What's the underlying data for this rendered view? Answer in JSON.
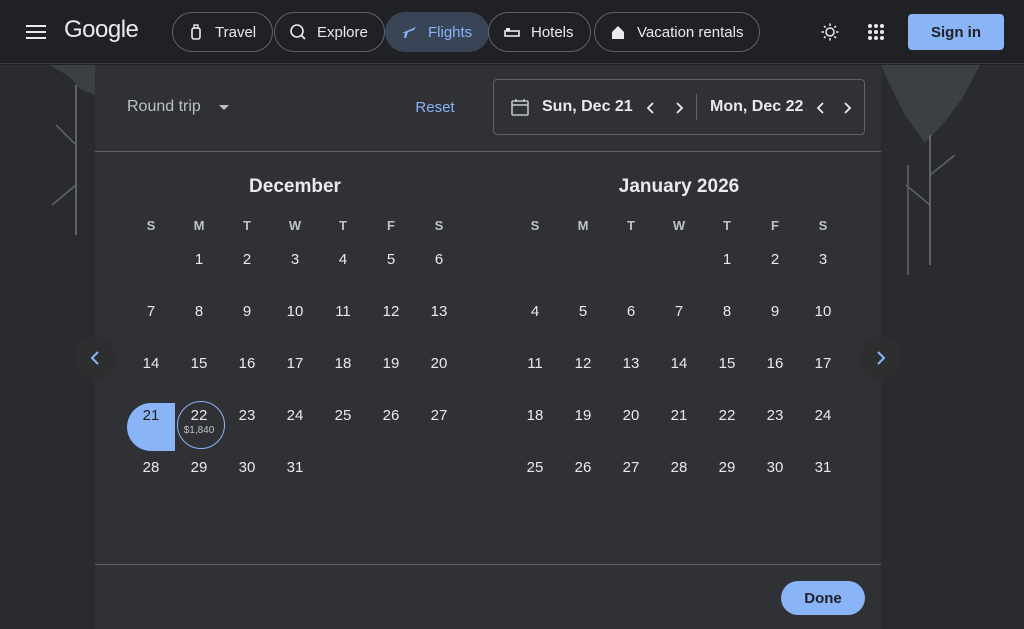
{
  "header": {
    "logo": "Google",
    "tabs": [
      {
        "label": "Travel",
        "icon": "suitcase-icon"
      },
      {
        "label": "Explore",
        "icon": "explore-icon"
      },
      {
        "label": "Flights",
        "icon": "airplane-icon",
        "active": true
      },
      {
        "label": "Hotels",
        "icon": "bed-icon"
      },
      {
        "label": "Vacation rentals",
        "icon": "house-icon"
      }
    ],
    "signin_label": "Sign in"
  },
  "dialog": {
    "trip_type": "Round trip",
    "reset_label": "Reset",
    "depart_date": "Sun, Dec 21",
    "return_date": "Mon, Dec 22",
    "done_label": "Done"
  },
  "calendar": {
    "weekdays": [
      "S",
      "M",
      "T",
      "W",
      "T",
      "F",
      "S"
    ],
    "months": [
      {
        "title": "December",
        "first_weekday": 1,
        "days": 31
      },
      {
        "title": "January 2026",
        "first_weekday": 4,
        "days": 31
      }
    ],
    "selected_start": {
      "month": 0,
      "day": 21
    },
    "selected_end": {
      "month": 0,
      "day": 22,
      "price": "$1,840"
    }
  },
  "colors": {
    "accent": "#8ab4f8",
    "background": "#202124",
    "dialog": "#303134"
  }
}
